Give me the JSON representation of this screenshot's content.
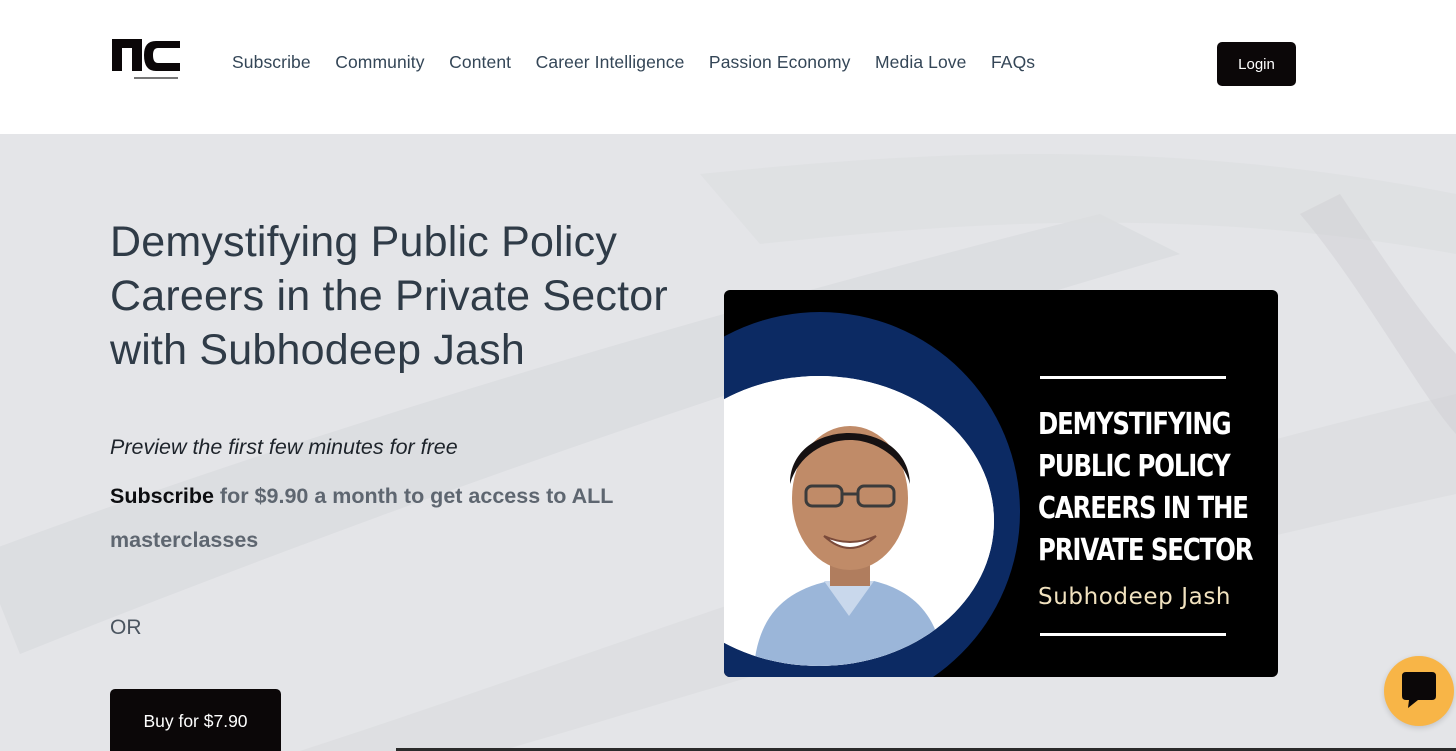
{
  "header": {
    "logo_alt": "Network Capital",
    "nav": [
      {
        "label": "Subscribe"
      },
      {
        "label": "Community"
      },
      {
        "label": "Content"
      },
      {
        "label": "Career Intelligence"
      },
      {
        "label": "Passion Economy"
      },
      {
        "label": "Media Love"
      },
      {
        "label": "FAQs"
      }
    ],
    "login_label": "Login"
  },
  "hero": {
    "title": "Demystifying Public Policy Careers in the Private Sector with Subhodeep Jash",
    "preview": "Preview the first few minutes for free",
    "subscribe_link": "Subscribe",
    "subscribe_rest": " for $9.90 a month to get access to ALL masterclasses",
    "or_text": "OR",
    "buy_label": "Buy for $7.90"
  },
  "thumbnail": {
    "title_lines": [
      "DEMYSTIFYING",
      "PUBLIC POLICY",
      "CAREERS IN THE",
      "PRIVATE SECTOR"
    ],
    "name": "Subhodeep Jash"
  },
  "colors": {
    "brand_dark": "#0b0708",
    "hero_bg": "#e4e5e8",
    "thumb_ring": "#0c2a63",
    "chat_accent": "#f8b547"
  },
  "icons": {
    "logo": "network-capital-logo",
    "chat": "chat-bubble-icon"
  }
}
